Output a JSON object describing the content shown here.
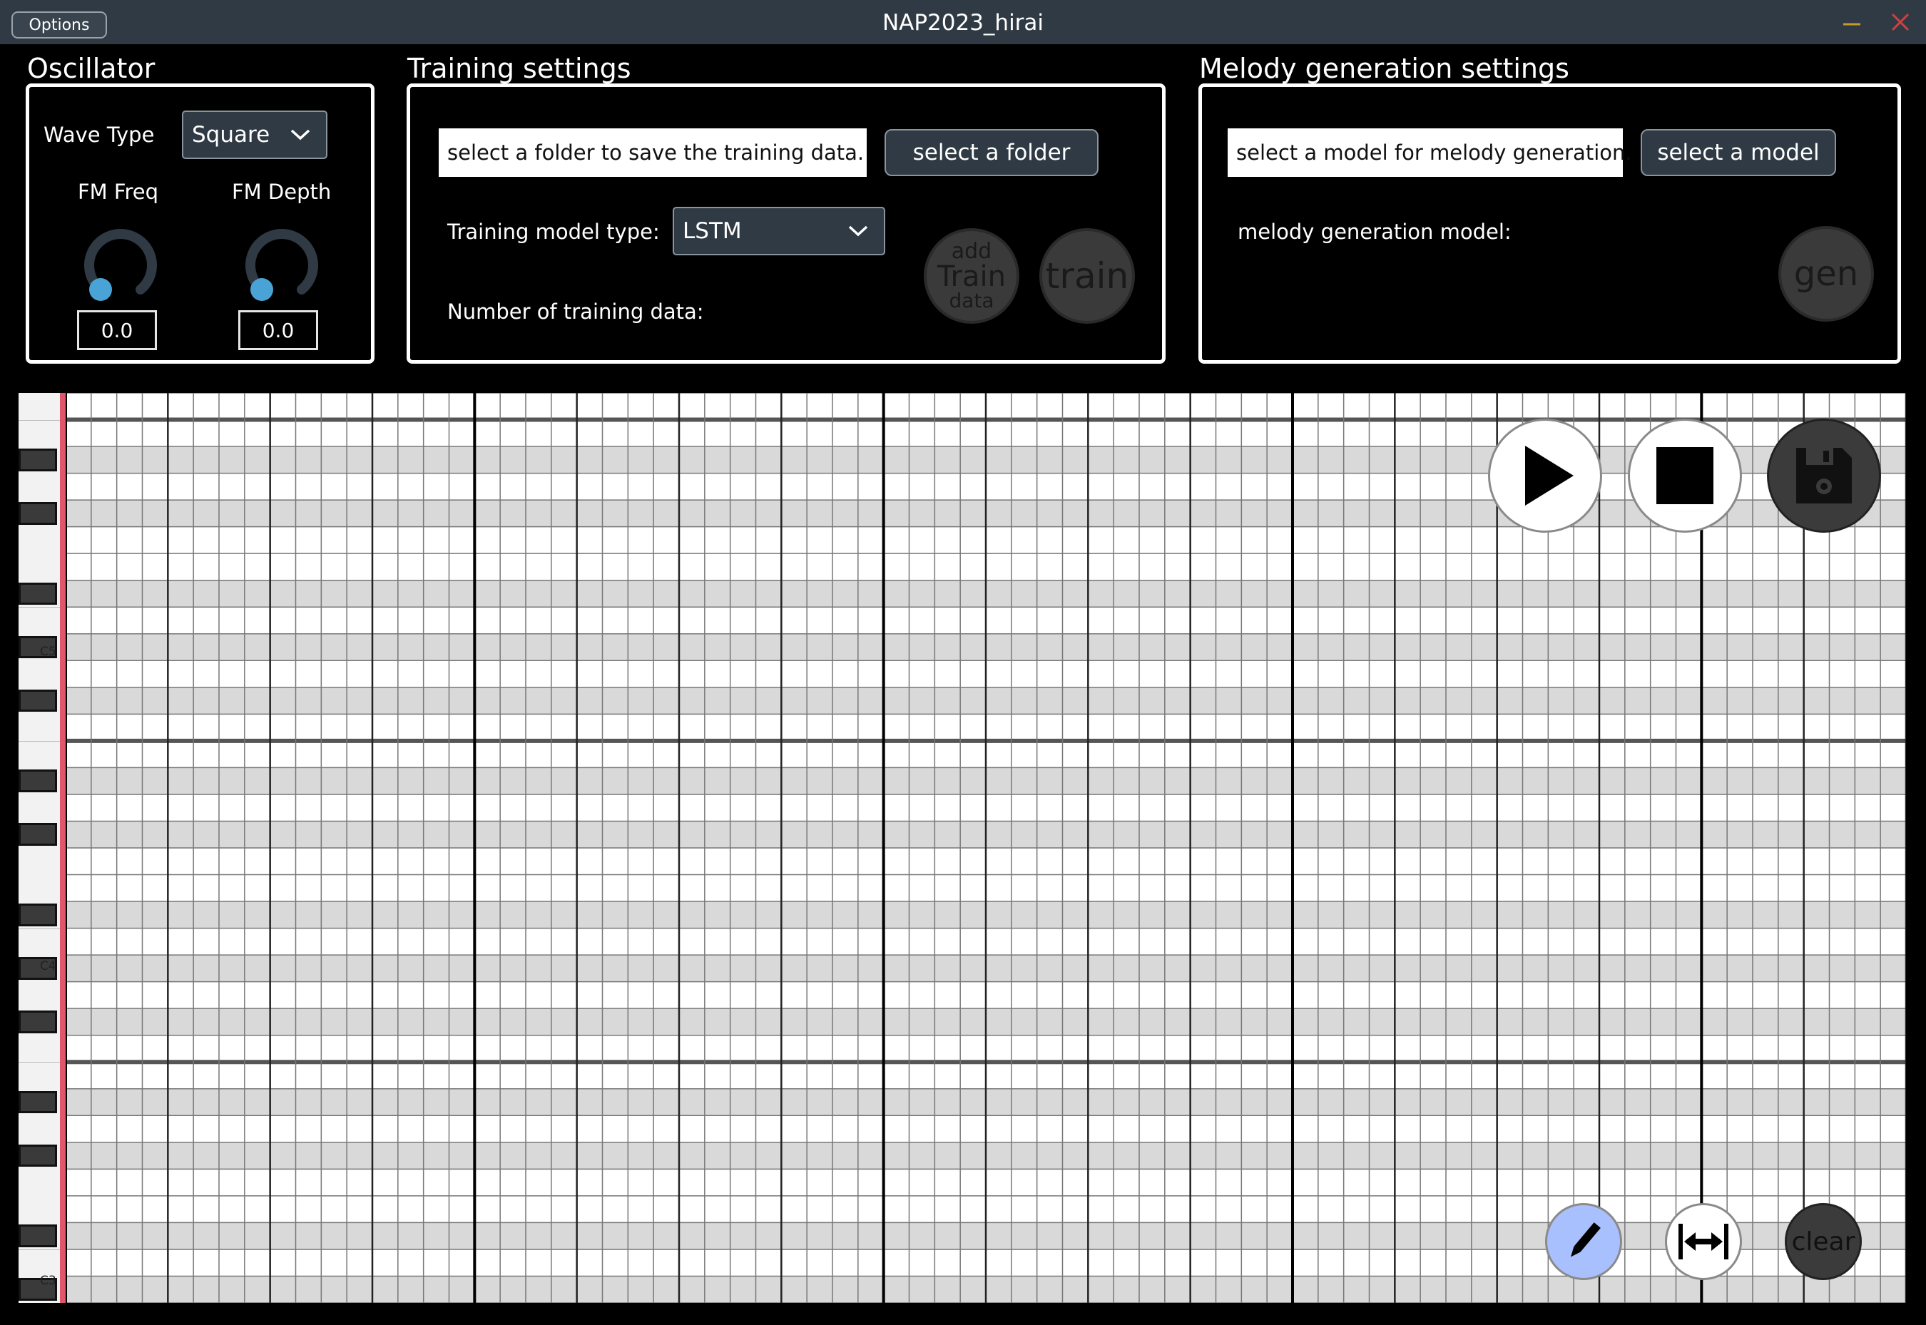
{
  "window": {
    "title": "NAP2023_hirai",
    "options_label": "Options"
  },
  "oscillator": {
    "title": "Oscillator",
    "wave_type_label": "Wave Type",
    "wave_type_value": "Square",
    "fm_freq_label": "FM Freq",
    "fm_depth_label": "FM Depth",
    "fm_freq_value": "0.0",
    "fm_depth_value": "0.0"
  },
  "training": {
    "title": "Training settings",
    "folder_field": "select a folder to save the training data.",
    "select_folder_label": "select a folder",
    "model_type_label": "Training model type:",
    "model_type_value": "LSTM",
    "num_data_label": "Number of training data:",
    "add_train_top": "add",
    "add_train_mid": "Train",
    "add_train_bot": "data",
    "train_label": "train"
  },
  "melody": {
    "title": "Melody generation settings",
    "model_field": "select a model for melody generation.",
    "select_model_label": "select a model",
    "model_label": "melody generation model:",
    "gen_label": "gen"
  },
  "piano_roll": {
    "octave_labels": [
      "C5",
      "C4",
      "C3"
    ],
    "clear_label": "clear"
  },
  "colors": {
    "knob_dot": "#4aa3d6",
    "accent_red": "#e0566a",
    "pencil_active": "#a9c0ff",
    "grid_light": "#ffffff",
    "grid_dark": "#d9d9d9"
  },
  "icons": [
    "minimize-icon",
    "close-icon",
    "chevron-down-icon",
    "play-icon",
    "stop-icon",
    "save-icon",
    "pencil-icon",
    "stretch-icon"
  ]
}
